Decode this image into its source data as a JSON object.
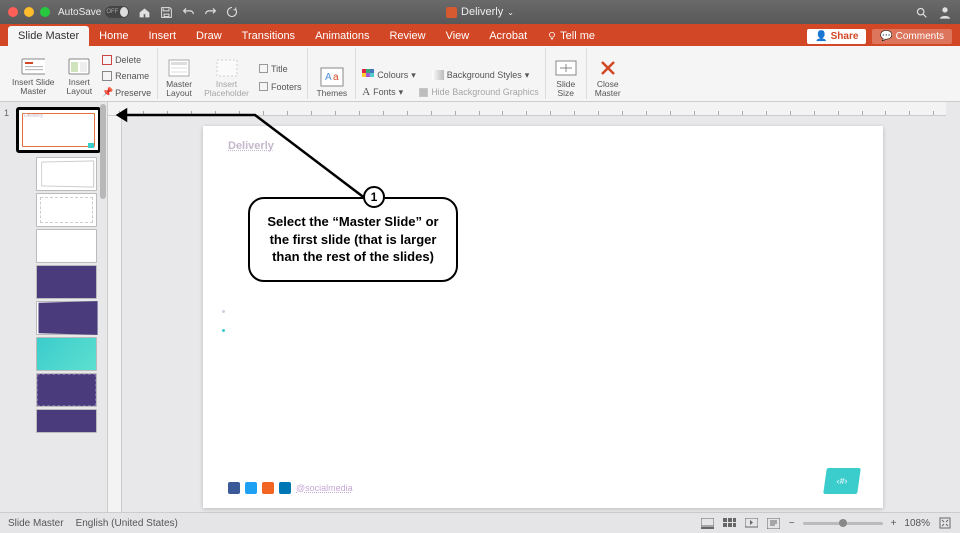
{
  "titlebar": {
    "autosave_label": "AutoSave",
    "autosave_state": "OFF",
    "doc_title": "Deliverly"
  },
  "tabs": {
    "items": [
      "Slide Master",
      "Home",
      "Insert",
      "Draw",
      "Transitions",
      "Animations",
      "Review",
      "View",
      "Acrobat"
    ],
    "active_index": 0,
    "tell_me": "Tell me",
    "share": "Share",
    "comments": "Comments"
  },
  "ribbon": {
    "insert_slide_master": "Insert Slide\nMaster",
    "insert_layout": "Insert\nLayout",
    "delete": "Delete",
    "rename": "Rename",
    "preserve": "Preserve",
    "master_layout": "Master\nLayout",
    "insert_placeholder": "Insert\nPlaceholder",
    "title_chk": "Title",
    "footers_chk": "Footers",
    "themes": "Themes",
    "colours": "Colours",
    "fonts": "Fonts",
    "bg_styles": "Background Styles",
    "hide_bg": "Hide Background Graphics",
    "slide_size": "Slide\nSize",
    "close_master": "Close\nMaster"
  },
  "slide": {
    "title": "Deliverly",
    "social_handle": "@socialmedia",
    "badge_text": "‹#›"
  },
  "callout": {
    "number": "1",
    "text": "Select the “Master Slide” or the first slide (that is larger than the rest of the slides)"
  },
  "statusbar": {
    "mode": "Slide Master",
    "lang": "English (United States)",
    "zoom": "108%"
  },
  "colors": {
    "accent": "#d24726",
    "teal": "#3bcccc",
    "purple": "#4a3b7c"
  }
}
